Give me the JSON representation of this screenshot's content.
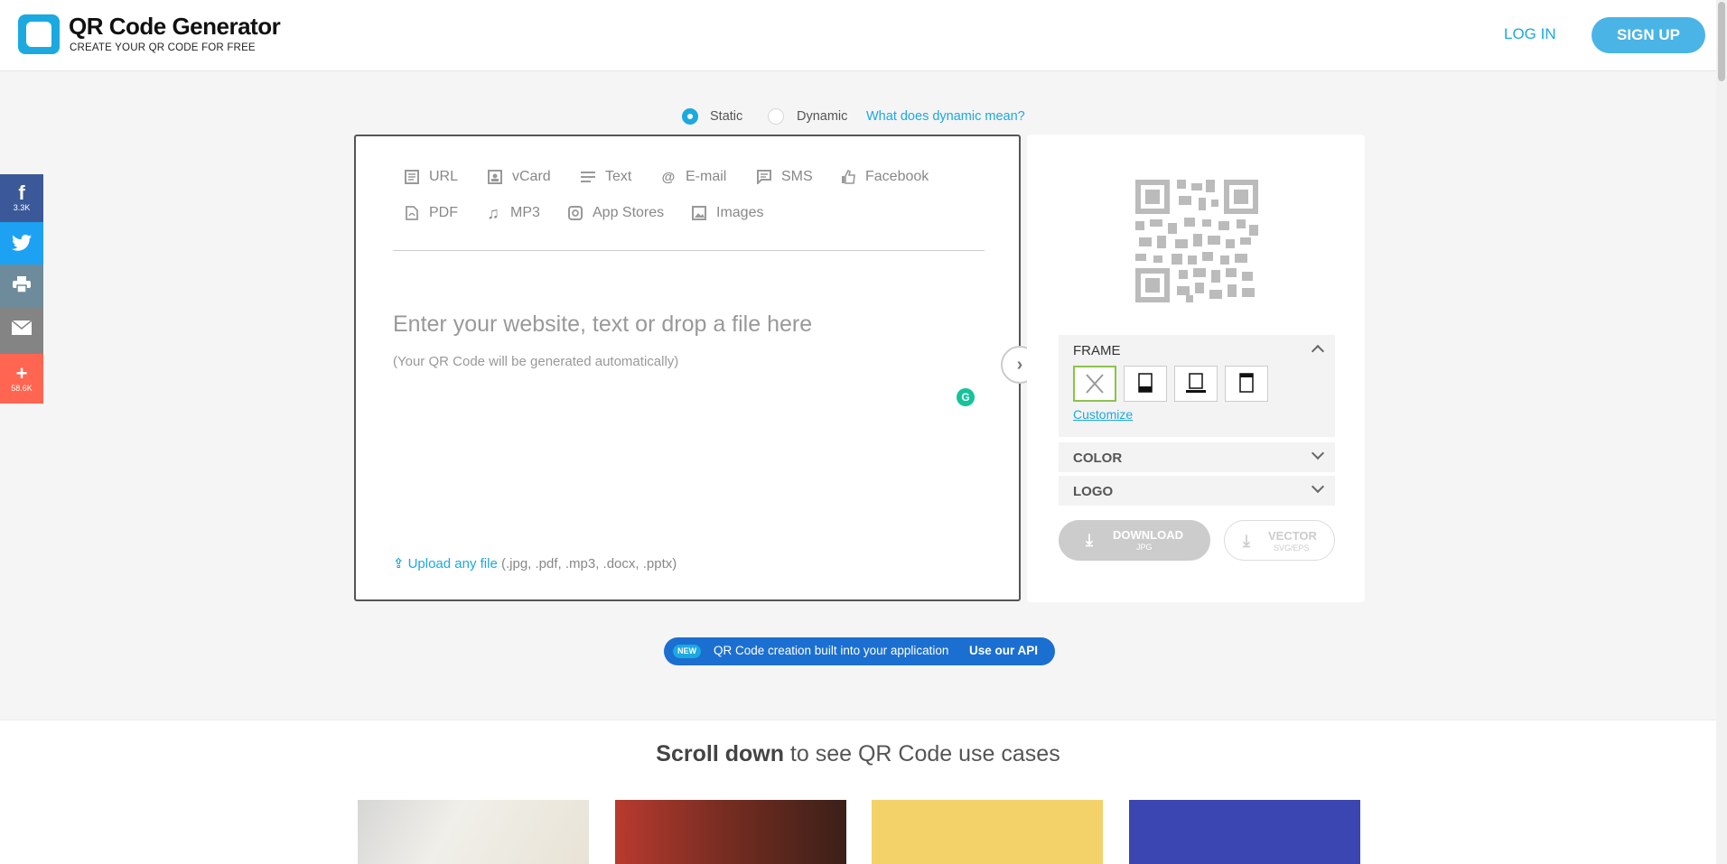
{
  "brand": {
    "title": "QR Code Generator",
    "tagline": "CREATE YOUR QR CODE FOR FREE",
    "accent": "#1ba9e0"
  },
  "header": {
    "login_label": "LOG IN",
    "signup_label": "SIGN UP"
  },
  "social": {
    "facebook_count": "3.3K",
    "share_count": "58.6K"
  },
  "mode": {
    "static_label": "Static",
    "dynamic_label": "Dynamic",
    "help_link": "What does dynamic mean?",
    "selected": "Static"
  },
  "editor": {
    "types_row1": [
      "URL",
      "vCard",
      "Text",
      "E-mail",
      "SMS",
      "Facebook"
    ],
    "types_row2": [
      "PDF",
      "MP3",
      "App Stores",
      "Images"
    ],
    "placeholder": "Enter your website, text or drop a file here",
    "hint": "(Your QR Code will be generated automatically)",
    "upload_link": "Upload any file",
    "upload_formats": "(.jpg, .pdf, .mp3, .docx, .pptx)"
  },
  "preview": {
    "frame_label": "FRAME",
    "customize_link": "Customize",
    "color_label": "COLOR",
    "logo_label": "LOGO",
    "download_label": "DOWNLOAD",
    "download_format": "JPG",
    "vector_label": "VECTOR",
    "vector_format": "SVG/EPS"
  },
  "api_banner": {
    "badge": "NEW",
    "message": "QR Code creation built into your application",
    "cta": "Use our API"
  },
  "use_cases": {
    "title_bold": "Scroll down",
    "title_rest": " to see QR Code use cases"
  }
}
